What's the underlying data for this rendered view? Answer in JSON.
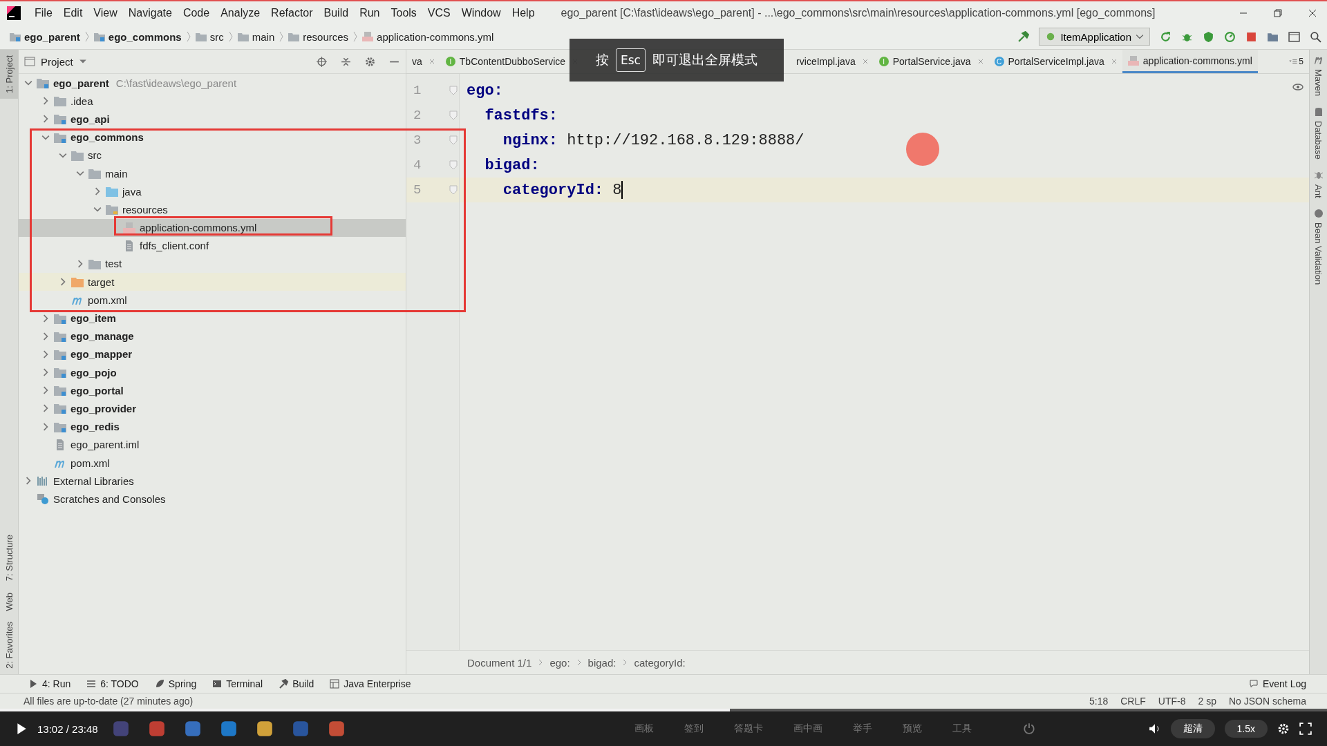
{
  "window": {
    "title": "ego_parent [C:\\fast\\ideaws\\ego_parent] - ...\\ego_commons\\src\\main\\resources\\application-commons.yml [ego_commons]"
  },
  "menu": [
    "File",
    "Edit",
    "View",
    "Navigate",
    "Code",
    "Analyze",
    "Refactor",
    "Build",
    "Run",
    "Tools",
    "VCS",
    "Window",
    "Help"
  ],
  "navigation_bar": {
    "breadcrumbs": [
      {
        "label": "ego_parent",
        "kind": "module"
      },
      {
        "label": "ego_commons",
        "kind": "module"
      },
      {
        "label": "src",
        "kind": "folder"
      },
      {
        "label": "main",
        "kind": "folder"
      },
      {
        "label": "resources",
        "kind": "folder"
      },
      {
        "label": "application-commons.yml",
        "kind": "yml"
      }
    ],
    "run_configuration": "ItemApplication"
  },
  "left_tool_strip": {
    "top": [
      {
        "label": "1: Project",
        "selected": true
      }
    ],
    "bottom": [
      {
        "label": "7: Structure",
        "selected": false
      },
      {
        "label": "Web",
        "selected": false
      },
      {
        "label": "2: Favorites",
        "selected": false
      }
    ]
  },
  "project_panel": {
    "title": "Project",
    "tree": [
      {
        "label": "ego_parent",
        "hint": "C:\\fast\\ideaws\\ego_parent",
        "kind": "module",
        "expanded": true,
        "selected": false,
        "children": [
          {
            "label": ".idea",
            "kind": "folder",
            "expanded": false,
            "selected": false
          },
          {
            "label": "ego_api",
            "kind": "module",
            "expanded": false,
            "selected": false
          },
          {
            "label": "ego_commons",
            "kind": "module",
            "expanded": true,
            "selected": false,
            "children": [
              {
                "label": "src",
                "kind": "folder",
                "expanded": true,
                "selected": false,
                "children": [
                  {
                    "label": "main",
                    "kind": "folder",
                    "expanded": true,
                    "selected": false,
                    "children": [
                      {
                        "label": "java",
                        "kind": "source-folder",
                        "expanded": false,
                        "selected": false
                      },
                      {
                        "label": "resources",
                        "kind": "resource-folder",
                        "expanded": true,
                        "selected": false,
                        "children": [
                          {
                            "label": "application-commons.yml",
                            "kind": "yml",
                            "selected": true
                          },
                          {
                            "label": "fdfs_client.conf",
                            "kind": "text-file",
                            "selected": false
                          }
                        ]
                      }
                    ]
                  },
                  {
                    "label": "test",
                    "kind": "folder",
                    "expanded": false,
                    "selected": false
                  }
                ]
              },
              {
                "label": "target",
                "kind": "excluded-folder",
                "expanded": false,
                "selected": false
              },
              {
                "label": "pom.xml",
                "kind": "pom",
                "selected": false
              }
            ]
          },
          {
            "label": "ego_item",
            "kind": "module",
            "expanded": false,
            "selected": false
          },
          {
            "label": "ego_manage",
            "kind": "module",
            "expanded": false,
            "selected": false
          },
          {
            "label": "ego_mapper",
            "kind": "module",
            "expanded": false,
            "selected": false
          },
          {
            "label": "ego_pojo",
            "kind": "module",
            "expanded": false,
            "selected": false
          },
          {
            "label": "ego_portal",
            "kind": "module",
            "expanded": false,
            "selected": false
          },
          {
            "label": "ego_provider",
            "kind": "module",
            "expanded": false,
            "selected": false
          },
          {
            "label": "ego_redis",
            "kind": "module",
            "expanded": false,
            "selected": false
          },
          {
            "label": "ego_parent.iml",
            "kind": "iml",
            "selected": false
          },
          {
            "label": "pom.xml",
            "kind": "pom",
            "selected": false
          }
        ]
      },
      {
        "label": "External Libraries",
        "kind": "libraries",
        "expanded": false,
        "selected": false
      },
      {
        "label": "Scratches and Consoles",
        "kind": "scratches",
        "selected": false
      }
    ]
  },
  "editor": {
    "tabs": [
      {
        "label": "va",
        "kind": "plain",
        "selected": false
      },
      {
        "label": "TbContentDubboService",
        "kind": "interface",
        "badge": "I",
        "selected": false
      },
      {
        "label": "rviceImpl.java",
        "kind": "plain",
        "selected": false
      },
      {
        "label": "PortalService.java",
        "kind": "interface",
        "badge": "I",
        "selected": false
      },
      {
        "label": "PortalServiceImpl.java",
        "kind": "class",
        "badge": "C",
        "selected": false
      },
      {
        "label": "application-commons.yml",
        "kind": "yml",
        "selected": true
      }
    ],
    "hidden_tab_count": "5",
    "lines": [
      {
        "number": "1",
        "key": "ego:",
        "current": false
      },
      {
        "number": "2",
        "key": "  fastdfs:",
        "current": false
      },
      {
        "number": "3",
        "key": "    nginx:",
        "value": " http://192.168.8.129:8888/",
        "current": false
      },
      {
        "number": "4",
        "key": "  bigad:",
        "current": false
      },
      {
        "number": "5",
        "key": "    categoryId:",
        "value": " 8",
        "current": true
      }
    ],
    "breadcrumbs": [
      "Document 1/1",
      "ego:",
      "bigad:",
      "categoryId:"
    ]
  },
  "right_tool_strip": [
    {
      "label": "Maven",
      "kind": "maven"
    },
    {
      "label": "Database",
      "kind": "database"
    },
    {
      "label": "Ant",
      "kind": "ant"
    },
    {
      "label": "Bean Validation",
      "kind": "bean"
    }
  ],
  "tool_windows": [
    {
      "label": "4: Run",
      "kind": "run"
    },
    {
      "label": "6: TODO",
      "kind": "todo"
    },
    {
      "label": "Spring",
      "kind": "spring"
    },
    {
      "label": "Terminal",
      "kind": "terminal"
    },
    {
      "label": "Build",
      "kind": "build"
    },
    {
      "label": "Java Enterprise",
      "kind": "javaee"
    }
  ],
  "event_log": "Event Log",
  "status_bar": {
    "message": "All files are up-to-date (27 minutes ago)",
    "position": "5:18",
    "line_separator": "CRLF",
    "encoding": "UTF-8",
    "indent": "2 sp",
    "schema": "No JSON schema"
  },
  "fullscreen_toast": {
    "prefix": "按",
    "key": "Esc",
    "suffix": "即可退出全屏模式"
  },
  "player": {
    "time": "13:02 / 23:48",
    "level": 0.55,
    "tools": [
      "画板",
      "签到",
      "答题卡",
      "画中画",
      "举手",
      "预览",
      "工具"
    ],
    "quality": "超清",
    "speed": "1.5x"
  }
}
